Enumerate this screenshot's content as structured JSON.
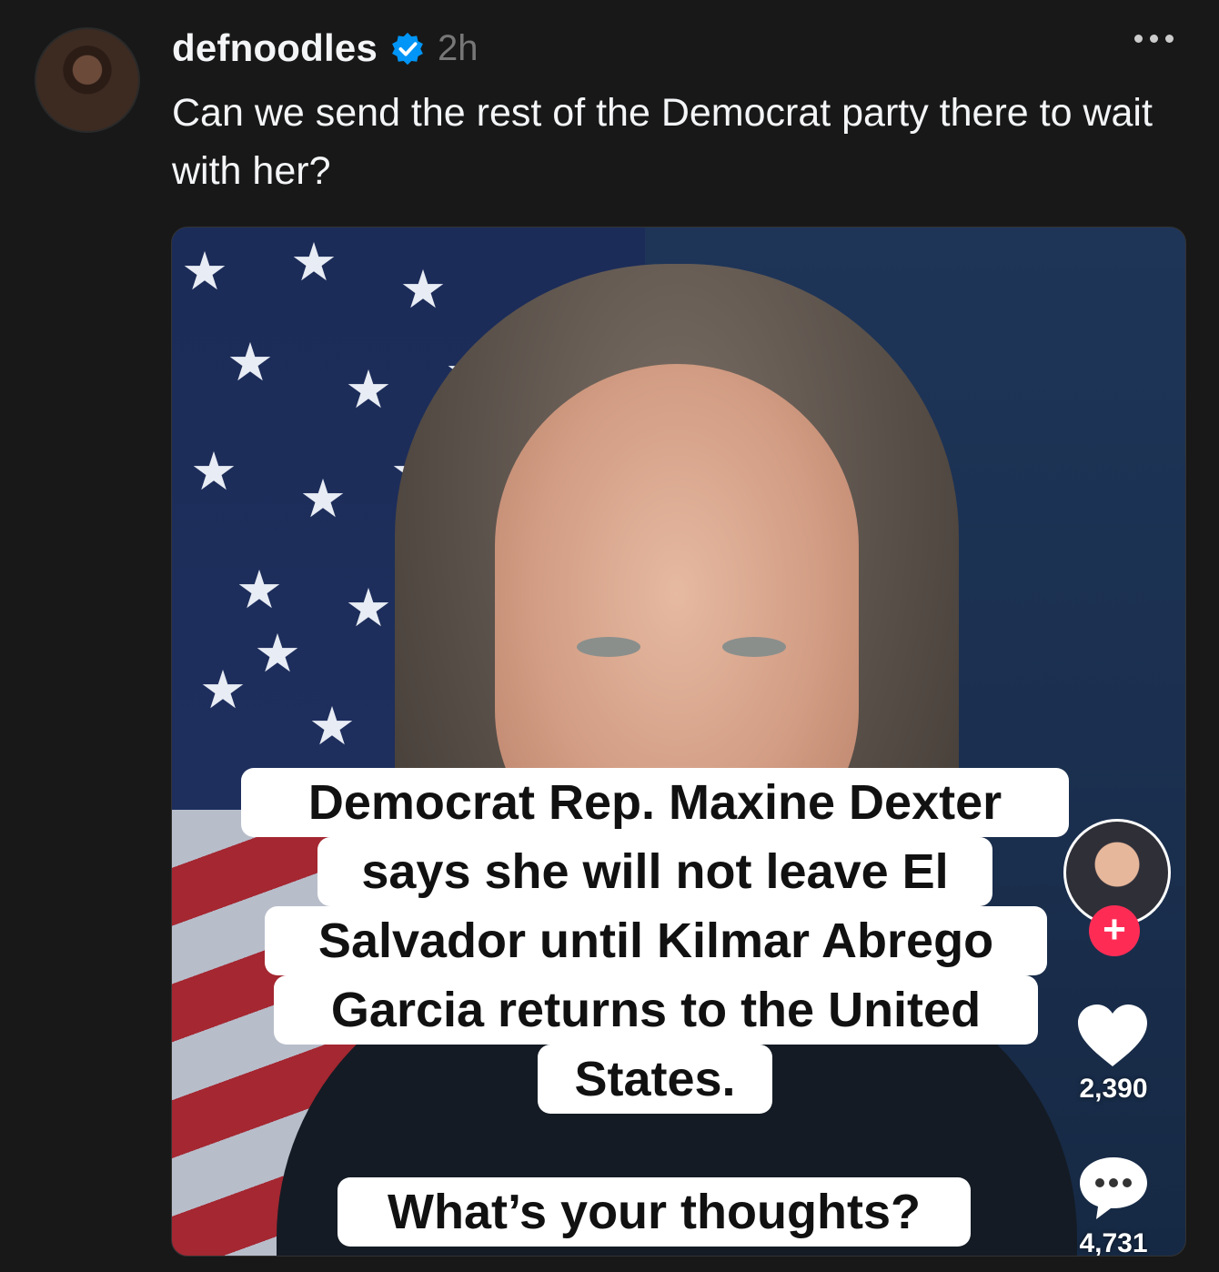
{
  "post": {
    "username": "defnoodles",
    "timestamp": "2h",
    "caption": "Can we send the rest of the Democrat party there to wait with her?",
    "verified": true,
    "accent_color": "#0095f6"
  },
  "media": {
    "overlay_lines": [
      "Democrat Rep. Maxine Dexter",
      "says she will not leave El",
      "Salvador until Kilmar Abrego",
      "Garcia returns to the United",
      "States."
    ],
    "question": "What’s your thoughts?",
    "likes": "2,390",
    "comments": "4,731",
    "follow_symbol": "+"
  }
}
